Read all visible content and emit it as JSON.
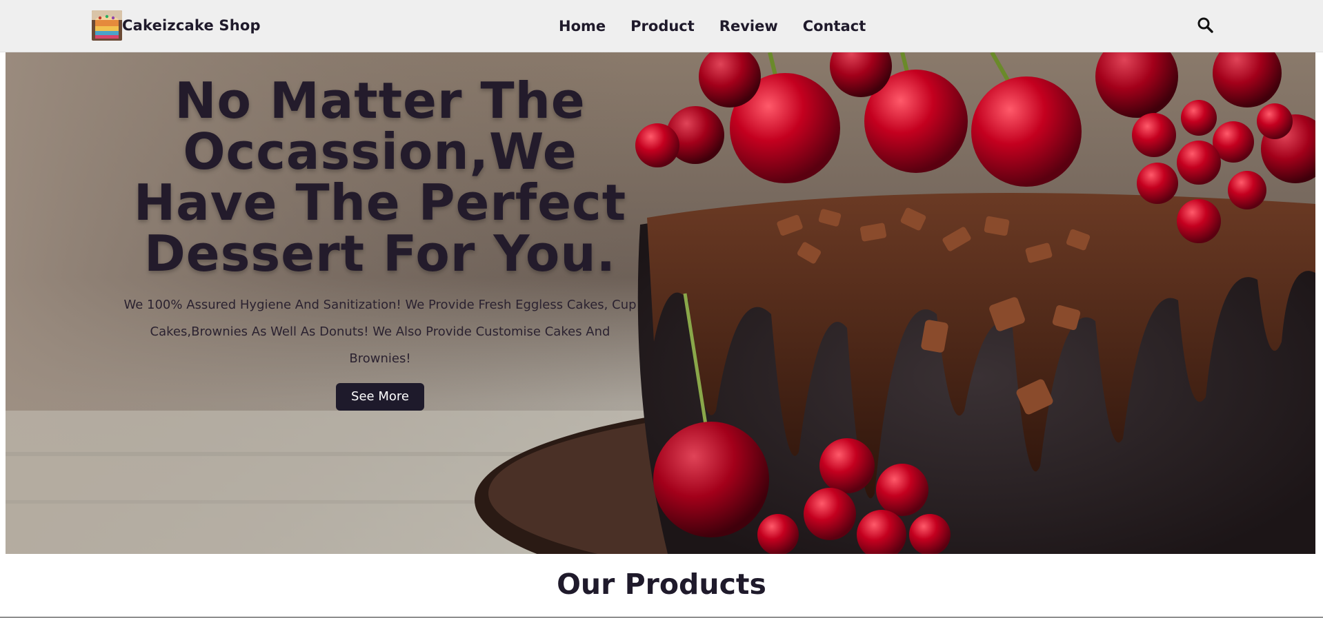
{
  "navbar": {
    "brand_name": "Cakeizcake Shop",
    "logo_icon": "cake-logo-icon",
    "links": [
      "Home",
      "Product",
      "Review",
      "Contact"
    ],
    "search_icon": "search-icon"
  },
  "hero": {
    "title": "No Matter The Occassion,We Have The Perfect Dessert For You.",
    "description": "We 100% Assured Hygiene And Sanitization! We Provide Fresh Eggless Cakes, Cup Cakes,Brownies As Well As Donuts! We Also Provide Customise Cakes And Brownies!",
    "button_label": "See More",
    "background_image": "chocolate-cherry-cake-photo"
  },
  "products_section": {
    "title": "Our Products"
  },
  "colors": {
    "navbar_bg": "#efefef",
    "primary_dark": "#1e1a2b",
    "text": "#1f1a2b"
  }
}
